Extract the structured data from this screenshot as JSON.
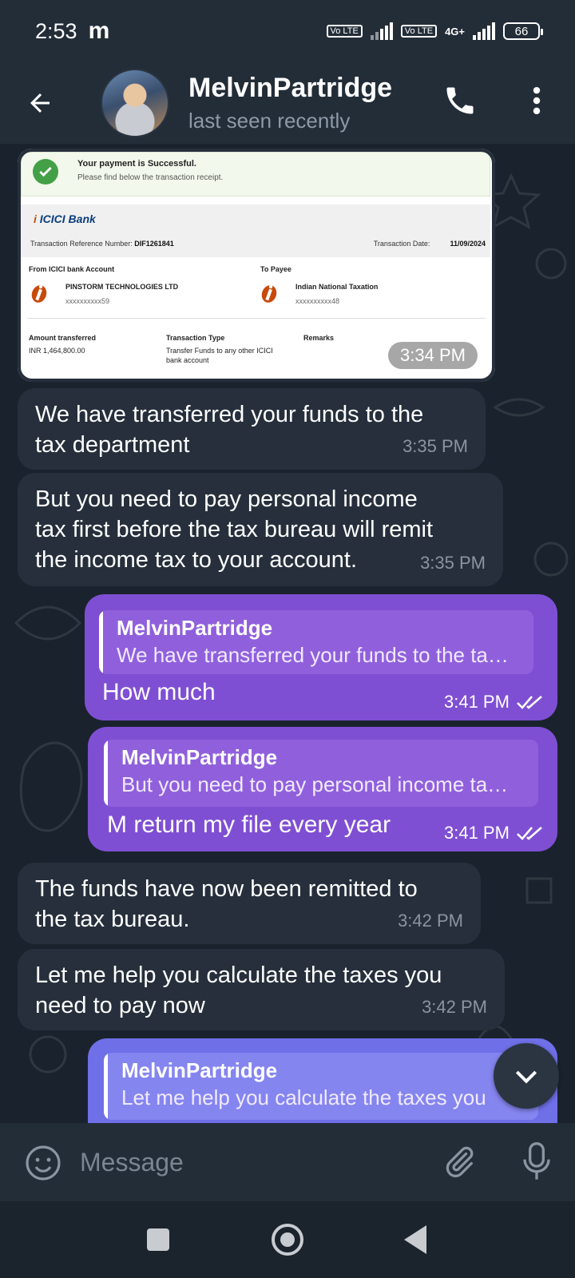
{
  "status_bar": {
    "time": "2:53",
    "app_indicator": "m",
    "sim1": "Vo LTE",
    "sim2": "Vo LTE",
    "network": "4G+",
    "battery": "66"
  },
  "header": {
    "name": "MelvinPartridge",
    "status": "last seen recently"
  },
  "receipt": {
    "title": "Your payment is Successful.",
    "subtitle": "Please find below the transaction receipt.",
    "bank": "ICICI Bank",
    "ref_label": "Transaction Reference Number:",
    "ref_value": "DIF1261841",
    "date_label": "Transaction Date:",
    "date_value": "11/09/2024",
    "from_label": "From ICICI bank Account",
    "from_name": "PINSTORM TECHNOLOGIES LTD",
    "from_acct": "xxxxxxxxxx59",
    "to_label": "To Payee",
    "to_name": "Indian National Taxation",
    "to_acct": "xxxxxxxxxx48",
    "amount_label": "Amount transferred",
    "amount_value": "INR 1,464,800.00",
    "type_label": "Transaction Type",
    "type_value_1": "Transfer Funds to any other ICICI",
    "type_value_2": "bank account",
    "remarks_label": "Remarks",
    "time": "3:34 PM"
  },
  "messages": [
    {
      "text_1": "We have transferred your funds to the",
      "text_2": "tax department",
      "time": "3:35 PM"
    },
    {
      "text_1": "But you need to pay personal income",
      "text_2": "tax first before the tax bureau will remit",
      "text_3": "the income tax to your account.",
      "time": "3:35 PM"
    },
    {
      "reply_name": "MelvinPartridge",
      "reply_text": "We have transferred your funds to the ta…",
      "text": "How much",
      "time": "3:41 PM"
    },
    {
      "reply_name": "MelvinPartridge",
      "reply_text": "But you need to pay personal income ta…",
      "text": "M return my file every year",
      "time": "3:41 PM"
    },
    {
      "text_1": "The funds have now been remitted to",
      "text_2": "the tax bureau.",
      "time": "3:42 PM"
    },
    {
      "text_1": "Let me help you calculate the taxes you",
      "text_2": "need to pay now",
      "time": "3:42 PM"
    },
    {
      "reply_name": "MelvinPartridge",
      "reply_text": "Let me help you calculate the taxes you"
    }
  ],
  "input": {
    "placeholder": "Message"
  },
  "icons": {
    "back": "arrow-left-icon",
    "call": "phone-icon",
    "more": "more-vertical-icon",
    "emoji": "smiley-icon",
    "attach": "paperclip-icon",
    "mic": "microphone-icon",
    "scroll": "chevron-down-icon"
  },
  "colors": {
    "outgoing_bubble": "#7f4fd3",
    "incoming_bubble": "#262f3b",
    "header": "#232d38"
  }
}
